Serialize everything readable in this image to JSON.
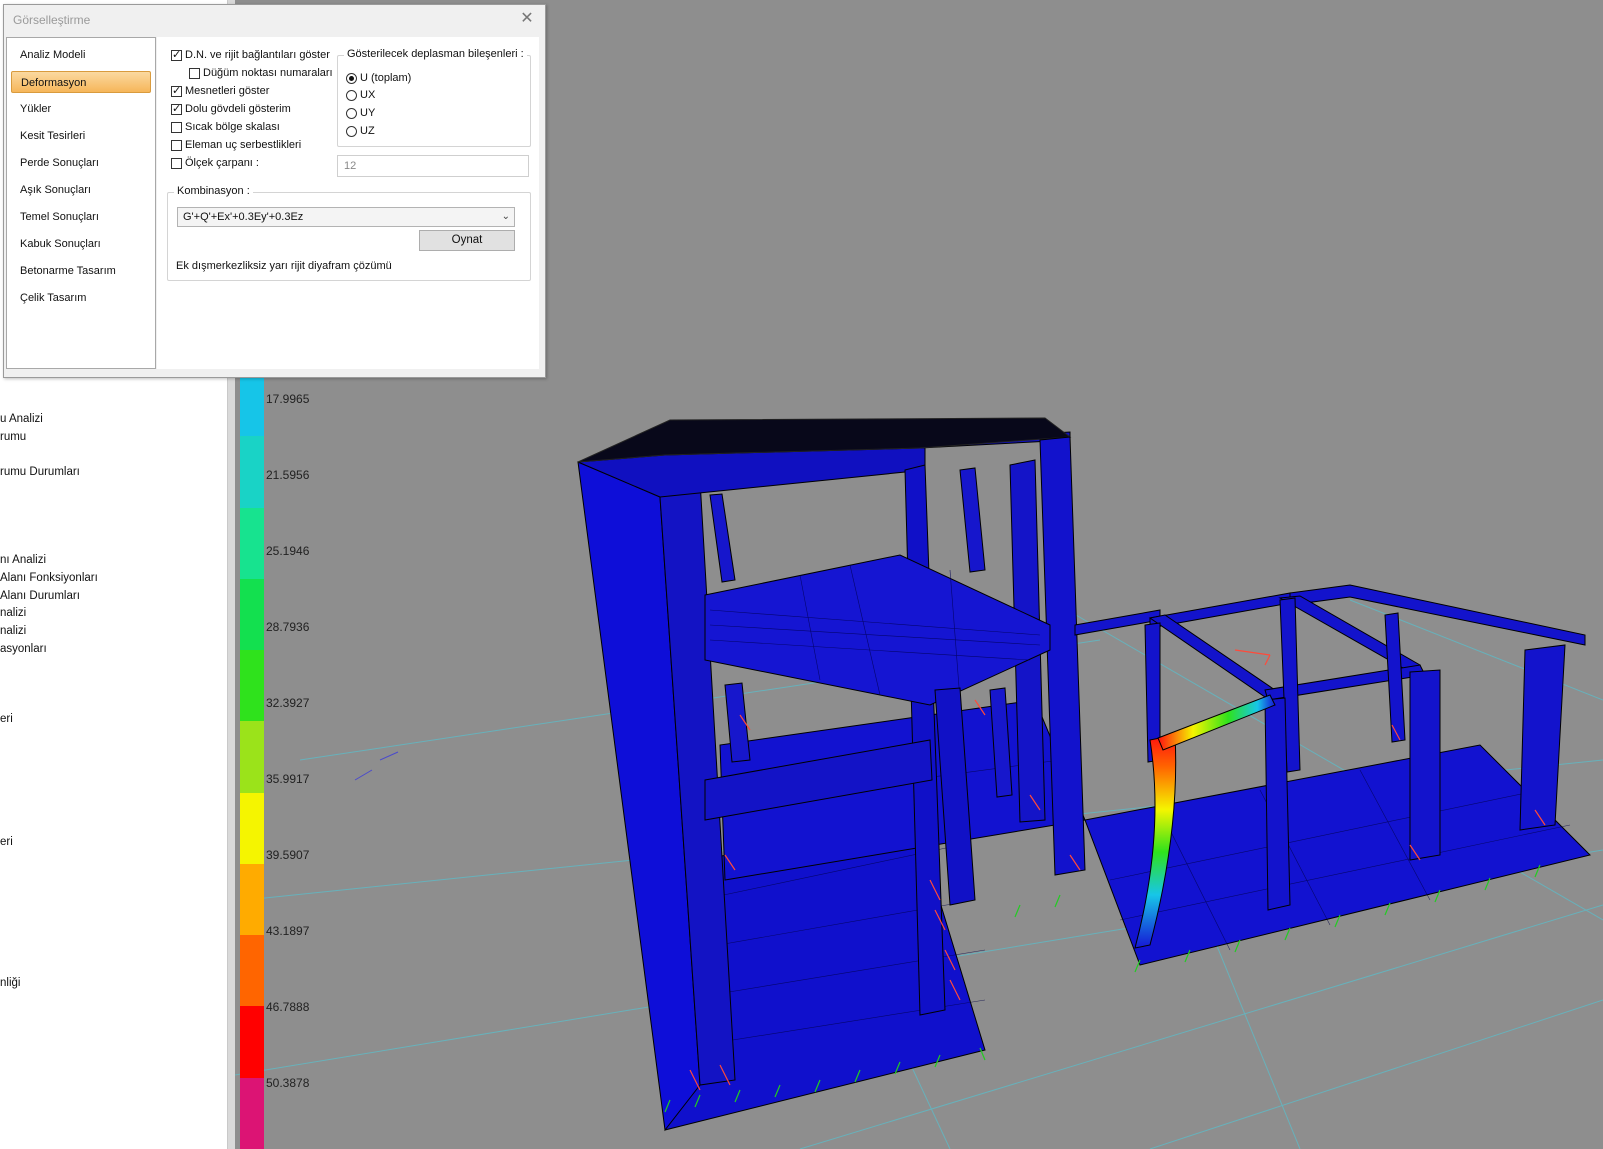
{
  "dialog": {
    "title": "Görselleştirme",
    "nav": [
      {
        "label": "Analiz Modeli",
        "active": false
      },
      {
        "label": "Deformasyon",
        "active": true
      },
      {
        "label": "Yükler",
        "active": false
      },
      {
        "label": "Kesit Tesirleri",
        "active": false
      },
      {
        "label": "Perde Sonuçları",
        "active": false
      },
      {
        "label": "Aşık Sonuçları",
        "active": false
      },
      {
        "label": "Temel Sonuçları",
        "active": false
      },
      {
        "label": "Kabuk Sonuçları",
        "active": false
      },
      {
        "label": "Betonarme Tasarım",
        "active": false
      },
      {
        "label": "Çelik Tasarım",
        "active": false
      }
    ],
    "options": [
      {
        "label": "D.N. ve rijit bağlantıları göster",
        "checked": true
      },
      {
        "label": "Düğüm noktası numaraları",
        "checked": false
      },
      {
        "label": "Mesnetleri göster",
        "checked": true
      },
      {
        "label": "Dolu gövdeli gösterim",
        "checked": true
      },
      {
        "label": "Sıcak bölge skalası",
        "checked": false
      },
      {
        "label": "Eleman uç serbestlikleri",
        "checked": false
      },
      {
        "label": "Ölçek çarpanı :",
        "checked": false
      }
    ],
    "scale_value": "12",
    "displacement_group": {
      "title": "Gösterilecek deplasman bileşenleri :",
      "options": [
        {
          "label": "U (toplam)",
          "selected": true
        },
        {
          "label": "UX",
          "selected": false
        },
        {
          "label": "UY",
          "selected": false
        },
        {
          "label": "UZ",
          "selected": false
        }
      ]
    },
    "combination": {
      "title": "Kombinasyon :",
      "value": "G'+Q'+Ex'+0.3Ey'+0.3Ez",
      "play_label": "Oynat",
      "note": "Ek dışmerkezliksiz yarı rijit diyafram çözümü"
    }
  },
  "left_panel_items": [
    "u Analizi",
    "rumu",
    "rumu Durumları",
    "nı Analizi",
    " Alanı Fonksiyonları",
    " Alanı Durumları",
    "nalizi",
    "nalizi",
    "asyonları",
    "eri",
    "eri",
    "nliği"
  ],
  "legend": {
    "labels": [
      "17.9965",
      "21.5956",
      "25.1946",
      "28.7936",
      "32.3927",
      "35.9917",
      "39.5907",
      "43.1897",
      "46.7888",
      "50.3878"
    ],
    "colors": [
      "#16c5e8",
      "#19d3c6",
      "#17e38f",
      "#13e04f",
      "#2fe21c",
      "#9be31a",
      "#f5f500",
      "#ffab00",
      "#ff6500",
      "#ff0000",
      "#dc1474"
    ]
  },
  "colors": {
    "structure": "#1010cc",
    "edge": "#000066",
    "background": "#8e8e8e",
    "grid": "#48cfe0"
  }
}
